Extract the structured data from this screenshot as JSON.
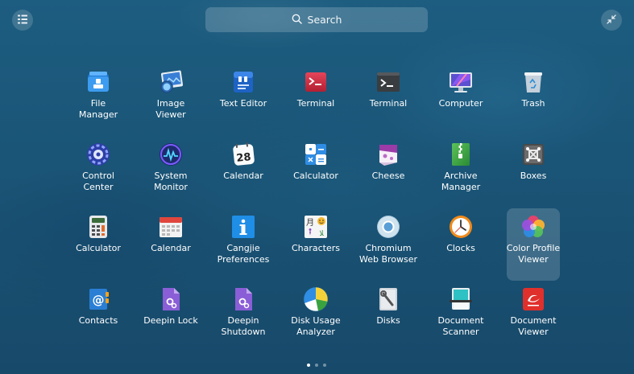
{
  "search": {
    "placeholder": "Search",
    "icon": "search-icon"
  },
  "apps": [
    {
      "label": "File\nManager",
      "icon": "folder-icon"
    },
    {
      "label": "Image\nViewer",
      "icon": "image-viewer-icon"
    },
    {
      "label": "Text Editor",
      "icon": "text-editor-icon"
    },
    {
      "label": "Terminal",
      "icon": "terminal-red-icon"
    },
    {
      "label": "Terminal",
      "icon": "terminal-dark-icon"
    },
    {
      "label": "Computer",
      "icon": "computer-icon"
    },
    {
      "label": "Trash",
      "icon": "trash-icon"
    },
    {
      "label": "Control\nCenter",
      "icon": "control-center-icon"
    },
    {
      "label": "System\nMonitor",
      "icon": "system-monitor-icon"
    },
    {
      "label": "Calendar",
      "icon": "calendar-28-icon",
      "badge": "28"
    },
    {
      "label": "Calculator",
      "icon": "calculator-blue-icon"
    },
    {
      "label": "Cheese",
      "icon": "cheese-icon"
    },
    {
      "label": "Archive\nManager",
      "icon": "archive-icon"
    },
    {
      "label": "Boxes",
      "icon": "boxes-icon"
    },
    {
      "label": "Calculator",
      "icon": "calculator-icon"
    },
    {
      "label": "Calendar",
      "icon": "calendar-icon"
    },
    {
      "label": "Cangjie\nPreferences",
      "icon": "info-icon"
    },
    {
      "label": "Characters",
      "icon": "characters-icon"
    },
    {
      "label": "Chromium\nWeb Browser",
      "icon": "chromium-icon"
    },
    {
      "label": "Clocks",
      "icon": "clock-icon"
    },
    {
      "label": "Color Profile\nViewer",
      "icon": "color-profile-icon",
      "hovered": true
    },
    {
      "label": "Contacts",
      "icon": "contacts-icon"
    },
    {
      "label": "Deepin Lock",
      "icon": "deepin-lock-icon"
    },
    {
      "label": "Deepin\nShutdown",
      "icon": "deepin-shutdown-icon"
    },
    {
      "label": "Disk Usage\nAnalyzer",
      "icon": "disk-usage-icon"
    },
    {
      "label": "Disks",
      "icon": "disks-icon"
    },
    {
      "label": "Document\nScanner",
      "icon": "scanner-icon"
    },
    {
      "label": "Document\nViewer",
      "icon": "document-viewer-icon"
    }
  ],
  "pages": {
    "count": 3,
    "current": 1
  },
  "colors": {
    "background": "#1b587b",
    "hover": "rgba(255,255,255,0.17)"
  }
}
